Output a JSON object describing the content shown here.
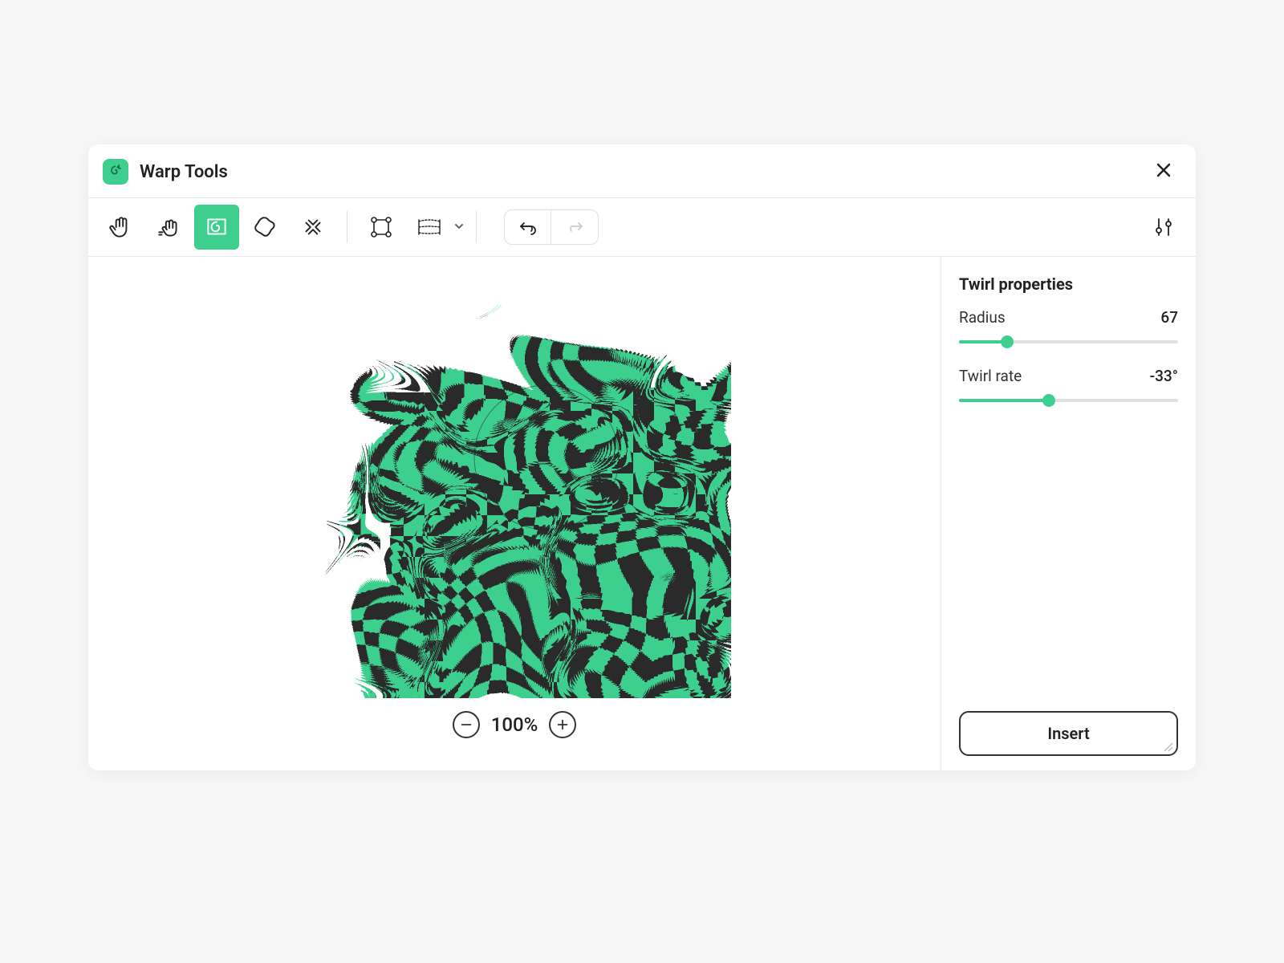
{
  "window": {
    "title": "Warp Tools"
  },
  "toolbar": {
    "tools": [
      "hand",
      "smudge",
      "twirl",
      "bloat",
      "shatter"
    ],
    "active_tool": "twirl",
    "modes": [
      "mesh",
      "grid"
    ]
  },
  "zoom": {
    "value": "100%"
  },
  "properties": {
    "title": "Twirl properties",
    "radius": {
      "label": "Radius",
      "value": "67",
      "percent": 22
    },
    "twirl_rate": {
      "label": "Twirl rate",
      "value": "-33°",
      "percent": 41
    }
  },
  "actions": {
    "insert": "Insert"
  },
  "colors": {
    "accent": "#3ecf8e"
  }
}
